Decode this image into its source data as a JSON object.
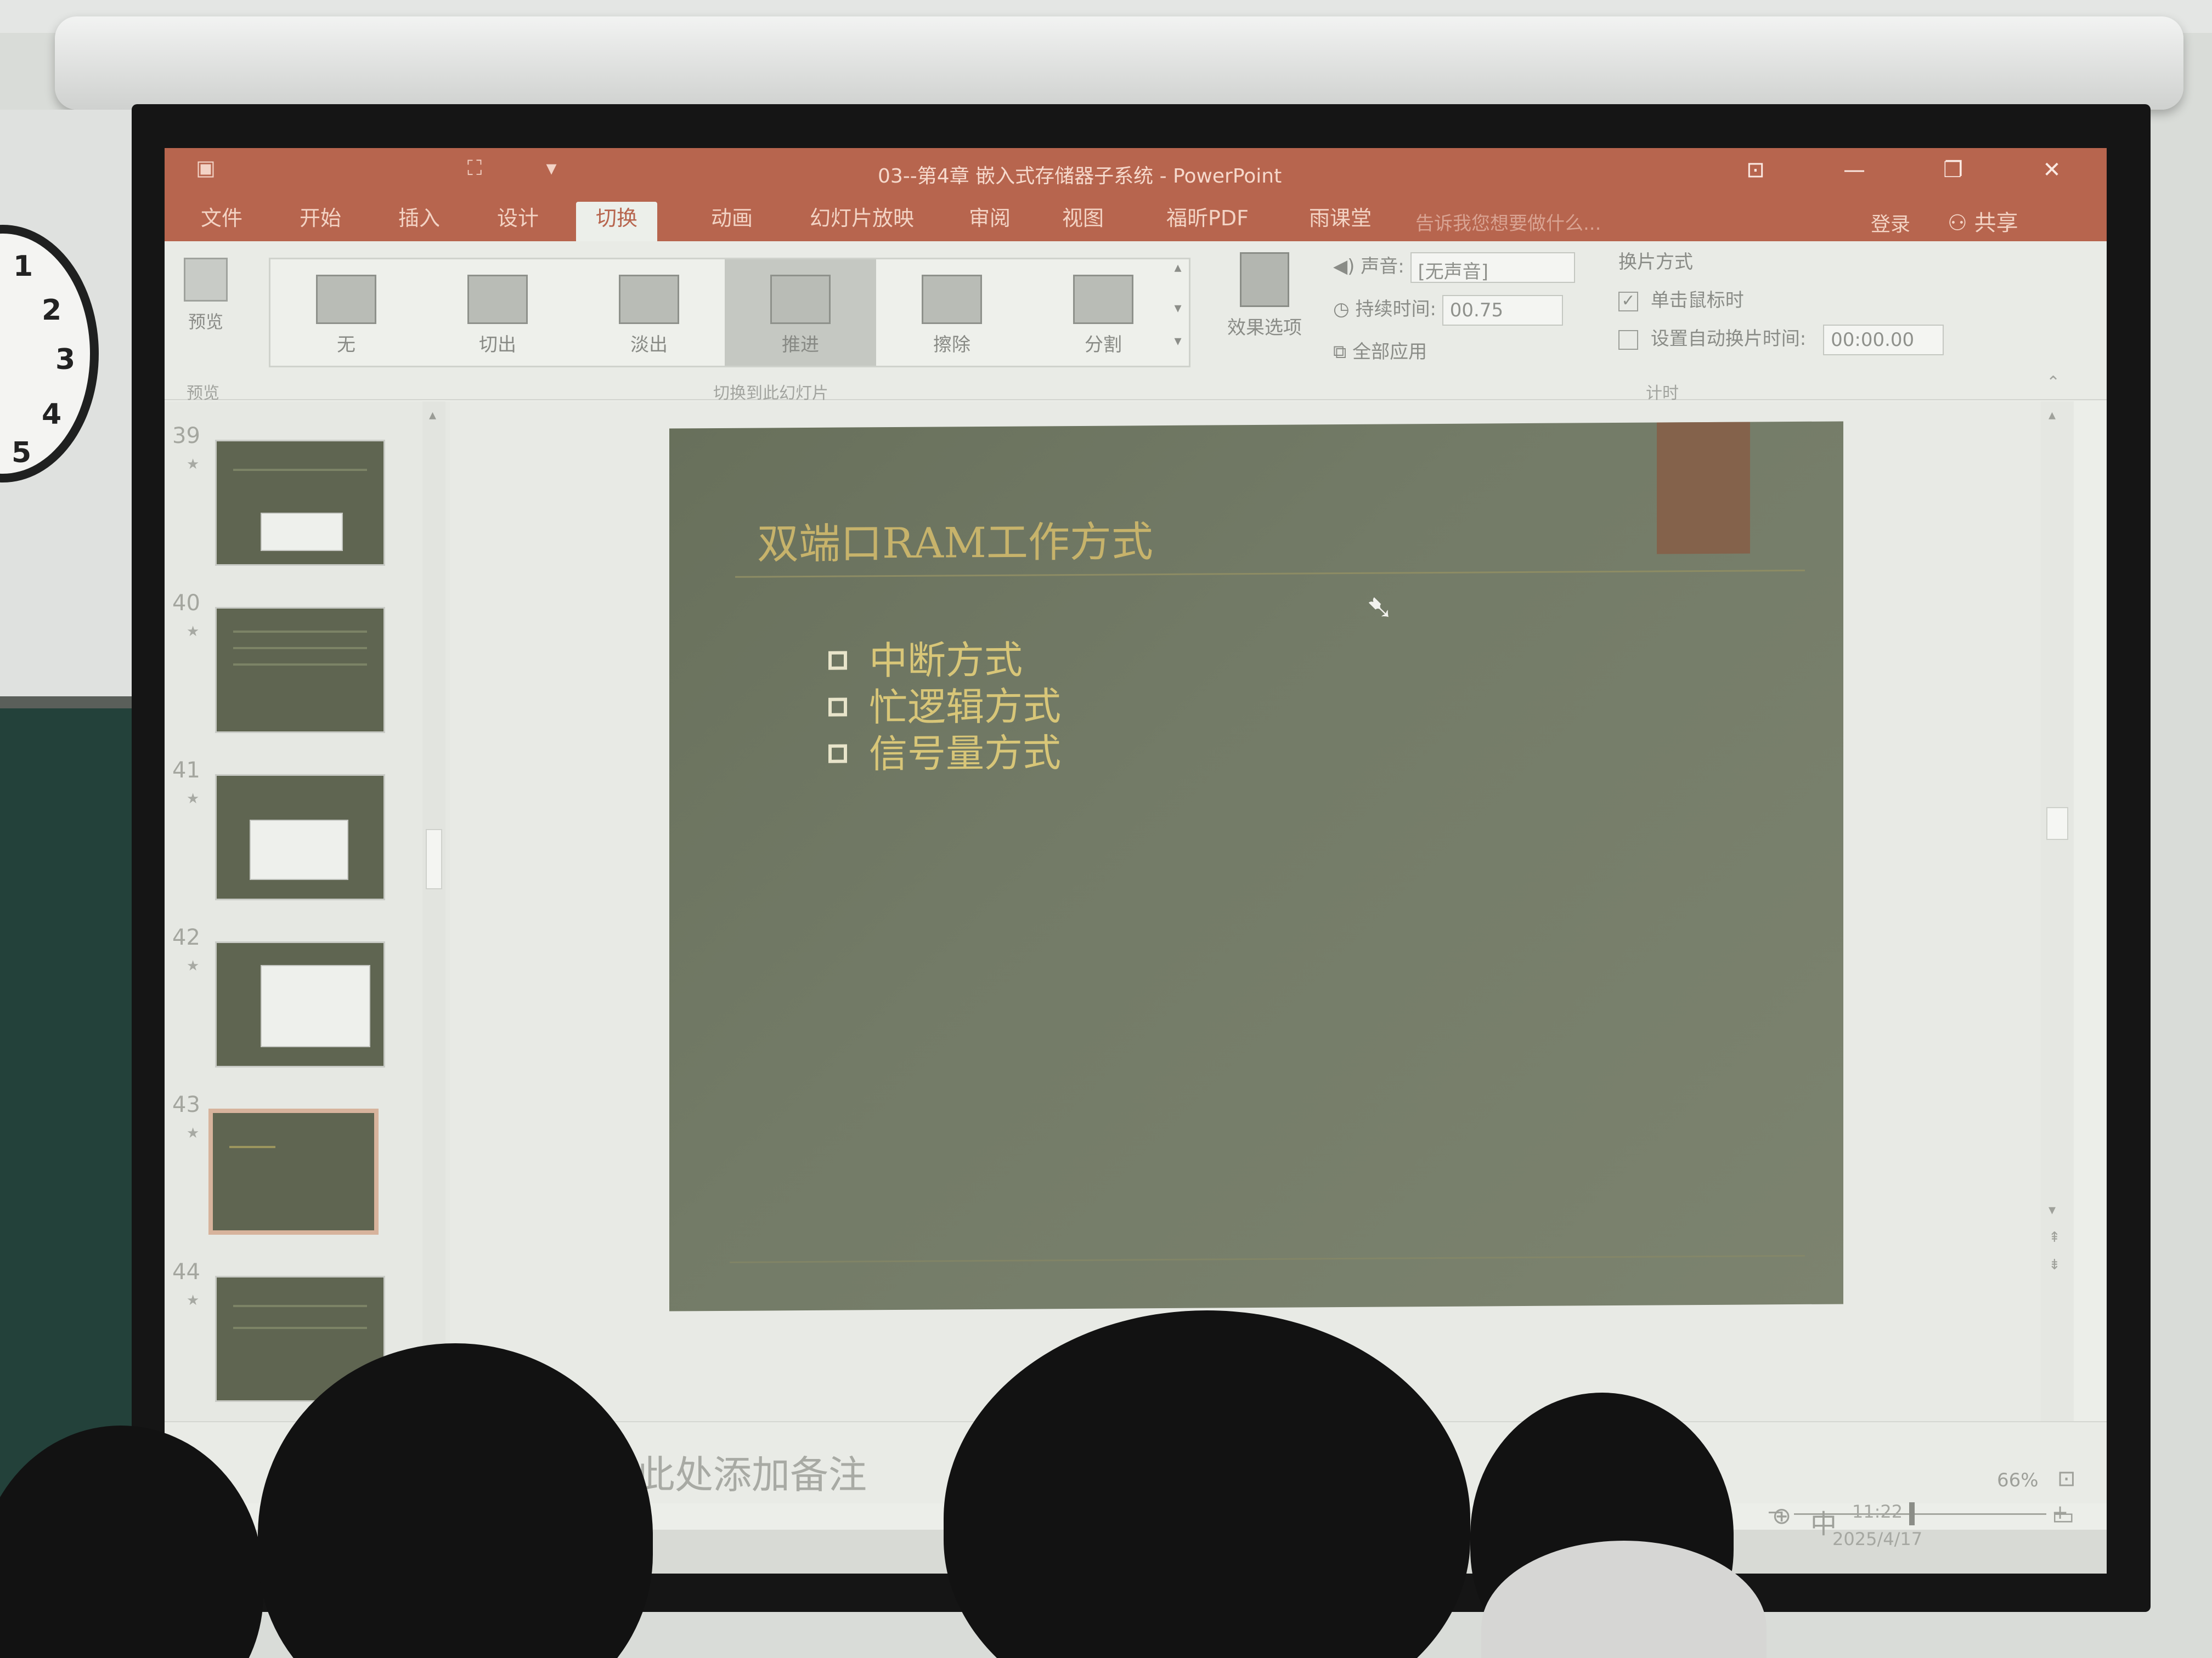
{
  "window": {
    "title": "03--第4章 嵌入式存储器子系统 - PowerPoint",
    "minimize": "—",
    "restore": "❐",
    "close": "✕",
    "ribbon_display": "⊡"
  },
  "tabs": [
    "文件",
    "开始",
    "插入",
    "设计",
    "切换",
    "动画",
    "幻灯片放映",
    "审阅",
    "视图",
    "福昕PDF",
    "雨课堂"
  ],
  "active_tab": "切换",
  "tell_me": "告诉我您想要做什么...",
  "signin": "登录",
  "share": "共享",
  "ribbon": {
    "preview_label": "预览",
    "preview_group": "预览",
    "transitions": [
      "无",
      "切出",
      "淡出",
      "推进",
      "擦除",
      "分割"
    ],
    "selected_transition": "推进",
    "transition_group": "切换到此幻灯片",
    "effect_options": "效果选项",
    "sound_label": "声音:",
    "sound_value": "[无声音]",
    "duration_label": "持续时间:",
    "duration_value": "00.75",
    "apply_all": "全部应用",
    "advance_label": "换片方式",
    "on_click": "单击鼠标时",
    "after_label": "设置自动换片时间:",
    "after_value": "00:00.00",
    "timing_group": "计时"
  },
  "slide_numbers": [
    "39",
    "40",
    "41",
    "42",
    "43",
    "44"
  ],
  "current_slide": "43",
  "slide": {
    "title": "双端口RAM工作方式",
    "bullets": [
      "中断方式",
      "忙逻辑方式",
      "信号量方式"
    ]
  },
  "notes_placeholder": "单击此处添加备注",
  "status": {
    "zoom": "66%"
  },
  "taskbar": {
    "ime": "中",
    "time": "11:22",
    "date": "2025/4/17"
  },
  "clock_numbers": [
    "1",
    "2",
    "3",
    "4",
    "5"
  ]
}
